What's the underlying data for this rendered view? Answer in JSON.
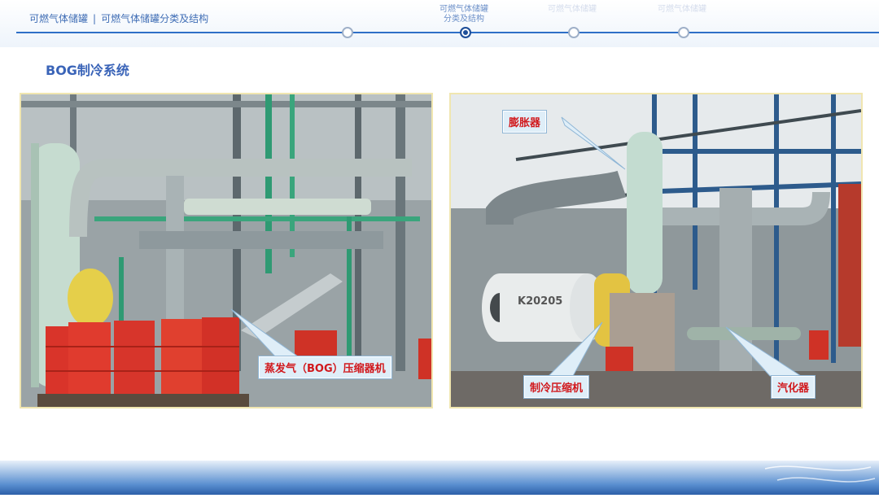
{
  "header": {
    "breadcrumb_main": "可燃气体储罐",
    "breadcrumb_sep": "|",
    "breadcrumb_sub": "可燃气体储罐分类及结构",
    "steps": [
      {
        "label": "可燃气体储罐\n分类及结构",
        "state": "active"
      },
      {
        "label": "可燃气体储罐",
        "state": "faded"
      },
      {
        "label": "可燃气体储罐",
        "state": "faded"
      }
    ]
  },
  "title": "BOG制冷系统",
  "photo_left": {
    "callout": "蒸发气（BOG）压缩器机"
  },
  "photo_right": {
    "callouts": {
      "expander": "膨胀器",
      "compressor": "制冷压缩机",
      "vaporizer": "汽化器"
    },
    "machine_tag": "K20205"
  },
  "colors": {
    "accent": "#2f6fc7",
    "callout_text": "#d1181c"
  }
}
